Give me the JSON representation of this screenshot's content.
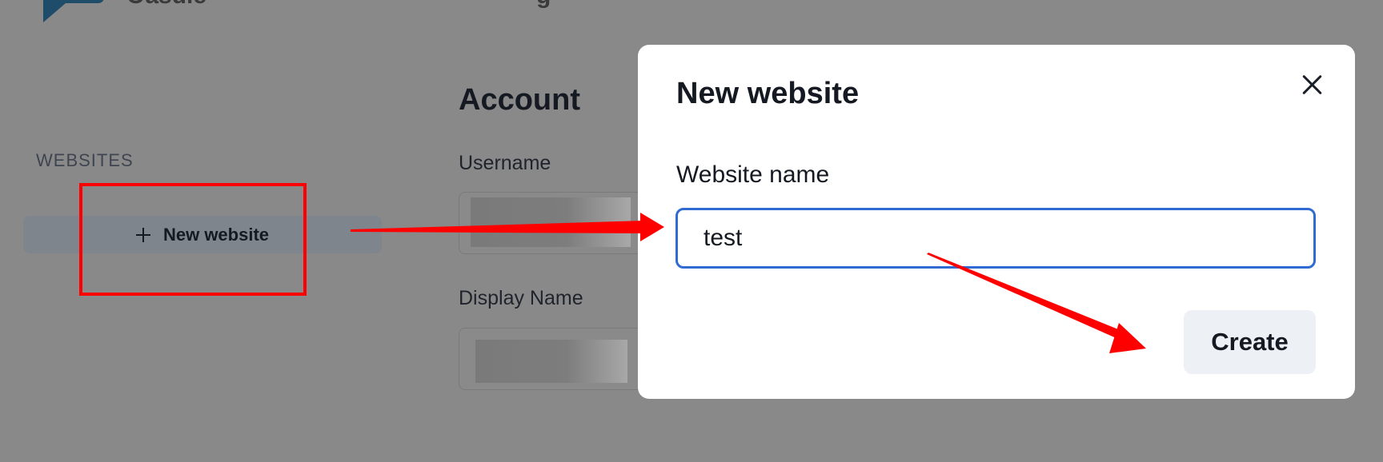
{
  "header": {
    "brand": "Oasdie",
    "partial_text": "g"
  },
  "sidebar": {
    "heading": "WEBSITES",
    "new_website_label": "New website"
  },
  "account": {
    "title": "Account",
    "username_label": "Username",
    "display_name_label": "Display Name"
  },
  "modal": {
    "title": "New website",
    "input_label": "Website name",
    "input_value": "test",
    "create_label": "Create"
  },
  "icons": {
    "plus": "plus-icon",
    "close": "close-icon",
    "logo": "chat-bubble-logo"
  },
  "colors": {
    "overlay": "#898989",
    "accent_annotation": "#ff0000",
    "input_focus": "#2f6bd1",
    "logo": "#1f4c68"
  }
}
